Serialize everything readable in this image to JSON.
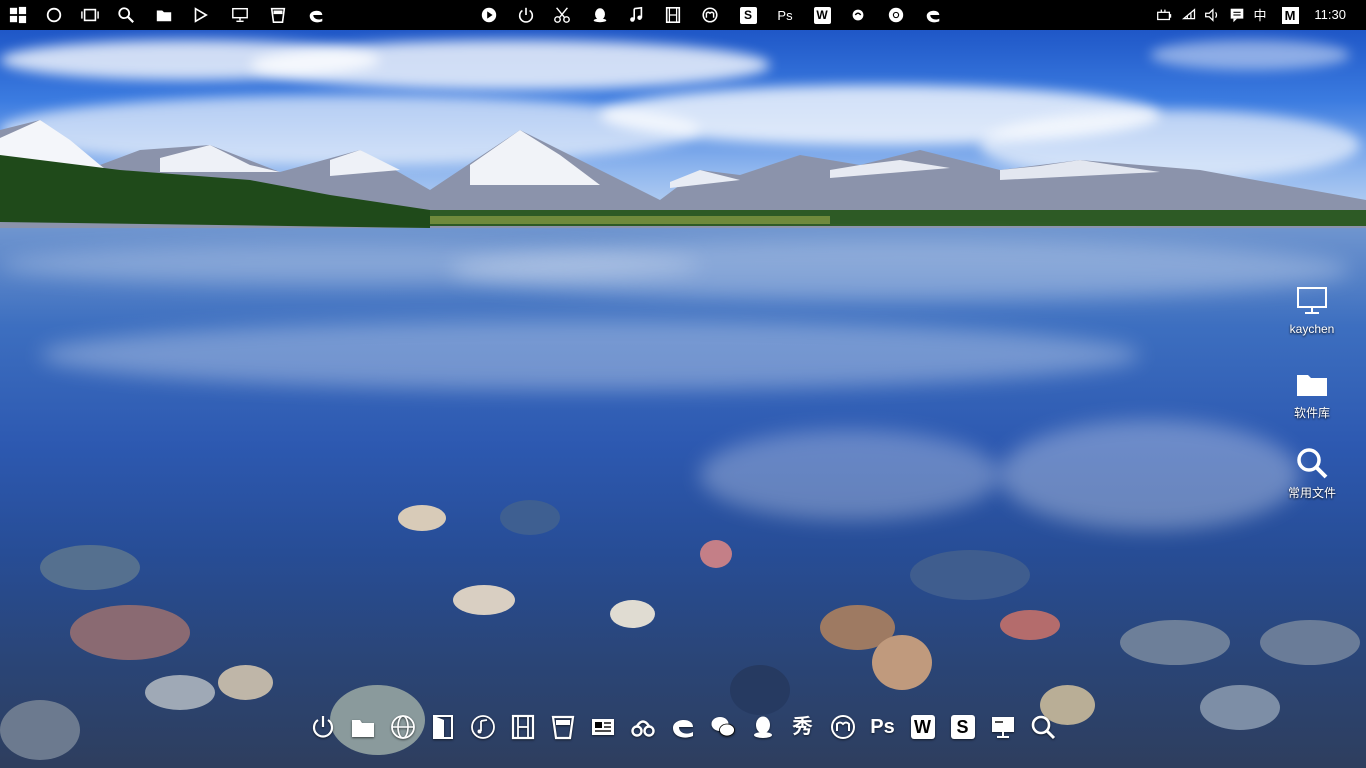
{
  "taskbar": {
    "left_icons": [
      "windows-logo",
      "cortana-circle",
      "task-view",
      "search",
      "file-explorer",
      "media-player",
      "monitor",
      "trash",
      "edge"
    ],
    "center_icons": [
      "play-circle",
      "power",
      "scissors",
      "qq",
      "music",
      "film",
      "m-app",
      "s-app",
      "photoshop",
      "w-app",
      "swirl-app",
      "chrome",
      "ie"
    ],
    "center_labels": {
      "s_app": "S",
      "photoshop": "Ps",
      "w_app": "W"
    },
    "tray": {
      "ime_label": "中",
      "m_label": "M",
      "time": "11:30"
    }
  },
  "desktop_icons": [
    {
      "label": "kaychen",
      "icon": "monitor-icon"
    },
    {
      "label": "软件库",
      "icon": "folder-icon"
    },
    {
      "label": "常用文件",
      "icon": "search-icon"
    }
  ],
  "dock": {
    "icons": [
      "power",
      "folder",
      "globe",
      "door",
      "music",
      "film",
      "trash",
      "id-card",
      "link",
      "edge",
      "wechat",
      "qq",
      "xiu",
      "m-app",
      "photoshop",
      "w-app",
      "s-app",
      "monitor",
      "search"
    ],
    "labels": {
      "xiu": "秀",
      "photoshop": "Ps",
      "w_app": "W",
      "s_app": "S"
    }
  },
  "colors": {
    "taskbar_bg": "#000000",
    "icon_fg": "#ffffff"
  }
}
